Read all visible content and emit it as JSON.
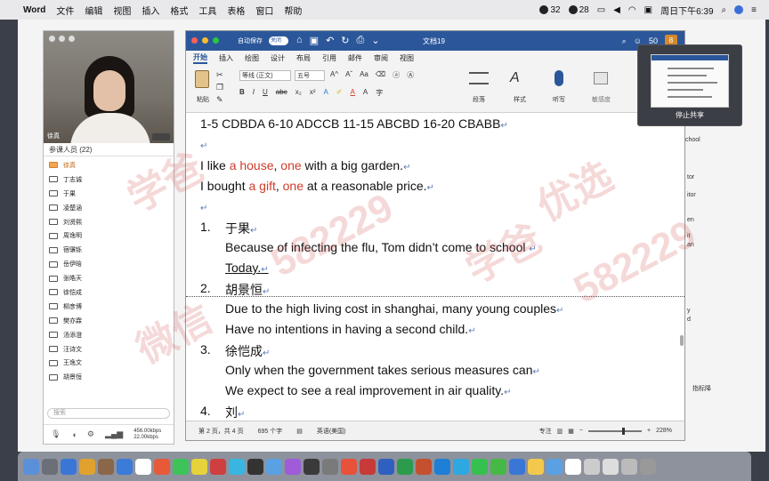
{
  "menubar": {
    "app": "Word",
    "items": [
      "文件",
      "编辑",
      "视图",
      "插入",
      "格式",
      "工具",
      "表格",
      "窗口",
      "帮助"
    ],
    "wechat_count": "32",
    "qq_count": "28",
    "clock": "周日下午6:39"
  },
  "meeting": {
    "host_video_name": "徐真",
    "participants_header": "参课人员 (22)",
    "participants": [
      {
        "name": "徐真",
        "host": true
      },
      {
        "name": "丁志诚",
        "host": false
      },
      {
        "name": "于果",
        "host": false
      },
      {
        "name": "凌楚涵",
        "host": false
      },
      {
        "name": "刘贤熙",
        "host": false
      },
      {
        "name": "周逸明",
        "host": false
      },
      {
        "name": "宿骥铄",
        "host": false
      },
      {
        "name": "岳伊晗",
        "host": false
      },
      {
        "name": "张皓天",
        "host": false
      },
      {
        "name": "徐恺成",
        "host": false
      },
      {
        "name": "柳彦博",
        "host": false
      },
      {
        "name": "樊亦霖",
        "host": false
      },
      {
        "name": "汤添澄",
        "host": false
      },
      {
        "name": "汪诗文",
        "host": false
      },
      {
        "name": "王逸文",
        "host": false
      },
      {
        "name": "胡景恒",
        "host": false
      }
    ],
    "search_placeholder": "搜索",
    "upload": "456.00kbps",
    "download": "22.00kbps"
  },
  "word": {
    "autosave_label": "自动保存",
    "autosave_state": "关闭",
    "doc_title": "文档19",
    "user_count": "50",
    "tabs": [
      "开始",
      "插入",
      "绘图",
      "设计",
      "布局",
      "引用",
      "邮件",
      "审阅",
      "视图"
    ],
    "active_tab": "开始",
    "share_label": "共享",
    "ribbon": {
      "paste": "粘贴",
      "font": "等线 (正文)",
      "size": "五号",
      "bold": "B",
      "italic": "I",
      "underline": "U",
      "strike": "abc",
      "sub": "x₂",
      "sup": "x²",
      "grow": "A^",
      "shrink": "Aˇ",
      "case": "Aa",
      "paragraph": "段落",
      "styles": "样式",
      "dictate": "听写",
      "sensitivity": "敏感度"
    },
    "doc_lines": {
      "answers": "1-5 CDBDA 6-10 ADCCB 11-15 ABCBD 16-20 CBABB",
      "s1_a": "I like ",
      "s1_hl1": "a house",
      "s1_b": ", ",
      "s1_hl2": "one",
      "s1_c": " with a big garden.",
      "s2_a": "I bought ",
      "s2_hl1": "a gift",
      "s2_b": ", ",
      "s2_hl2": "one",
      "s2_c": " at a reasonable price.",
      "item1_num": "1.",
      "item1_name": "于果",
      "item1_l1": "Because of infecting the flu, Tom didn’t come to school",
      "item1_l2": "Today.",
      "item2_num": "2.",
      "item2_name": "胡景恒",
      "item2_l1": "Due to the high living cost in shanghai, many young couples",
      "item2_l2": "Have no intentions in having a second child.",
      "item3_num": "3.",
      "item3_name": "徐恺成",
      "item3_l1": "Only when the government takes serious measures can",
      "item3_l2": "We expect to see a real improvement in air quality.",
      "item4_num": "4.",
      "item4_name": "刘"
    },
    "pilcrow": "↵",
    "status": {
      "page": "第 2 页，共 4 页",
      "words": "695 个字",
      "lang": "英语(美国)",
      "focus": "专注",
      "zoom": "228%"
    }
  },
  "share_preview": {
    "stop_label": "停止共享"
  },
  "side_text": [
    "chool",
    "tor",
    "itor",
    "en",
    "it",
    "an",
    "y",
    "d",
    "指标降"
  ],
  "watermark": {
    "text1": "学爸",
    "text2": "微信",
    "text3": "582229",
    "text4": "优选"
  }
}
